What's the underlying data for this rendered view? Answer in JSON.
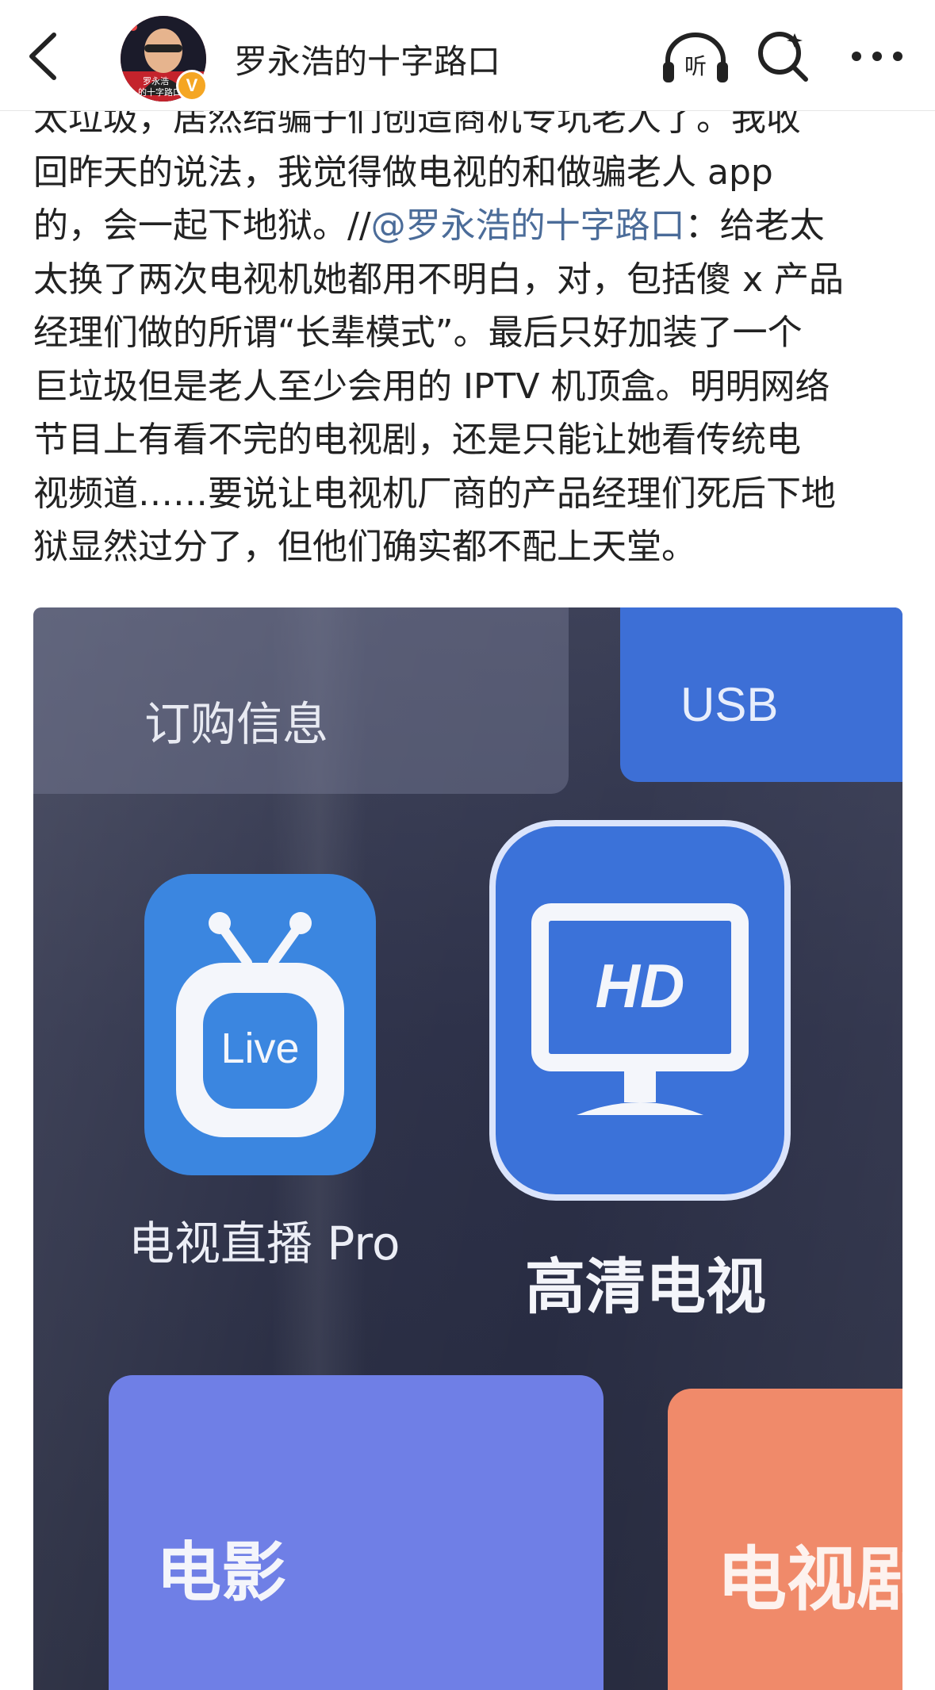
{
  "header": {
    "account_name": "罗永浩的十字路口",
    "avatar_caption_line1": "罗永浩",
    "avatar_caption_line2": "的十字路口",
    "verify_badge": "V",
    "listen_label": "听",
    "icons": {
      "back": "chevron-left-icon",
      "listen": "headphones-icon",
      "search": "search-icon",
      "more": "more-dots-icon"
    }
  },
  "post": {
    "line1": "太垃圾，居然给骗子们创造商机专坑老人了。我收",
    "line2": "回昨天的说法，我觉得做电视的和做骗老人 app",
    "line3_before": "的，会一起下地狱。//",
    "mention": "@罗永浩的十字路口",
    "line3_after": "：给老太",
    "line4": "太换了两次电视机她都用不明白，对，包括傻 x 产品",
    "line5": "经理们做的所谓“长辈模式”。最后只好加装了一个",
    "line6": "巨垃圾但是老人至少会用的 IPTV 机顶盒。明明网络",
    "line7": "节目上有看不完的电视剧，还是只能让她看传统电",
    "line8": "视频道……要说让电视机厂商的产品经理们死后下地",
    "line9": "狱显然过分了，但他们确实都不配上天堂。"
  },
  "photo": {
    "tile_order_info": "订购信息",
    "tile_usb": "USB",
    "live_icon_text": "Live",
    "live_app_label": "电视直播 Pro",
    "hd_icon_text": "HD",
    "hd_app_label": "高清电视",
    "tile_movie": "电影",
    "tile_tv_series": "电视剧"
  },
  "colors": {
    "mention": "#4b6c99",
    "text": "#222222",
    "tile_blue": "#3d6fd6",
    "tile_movie": "#6f7fe6",
    "tile_series": "#f08a6a",
    "badge": "#f5a623"
  }
}
